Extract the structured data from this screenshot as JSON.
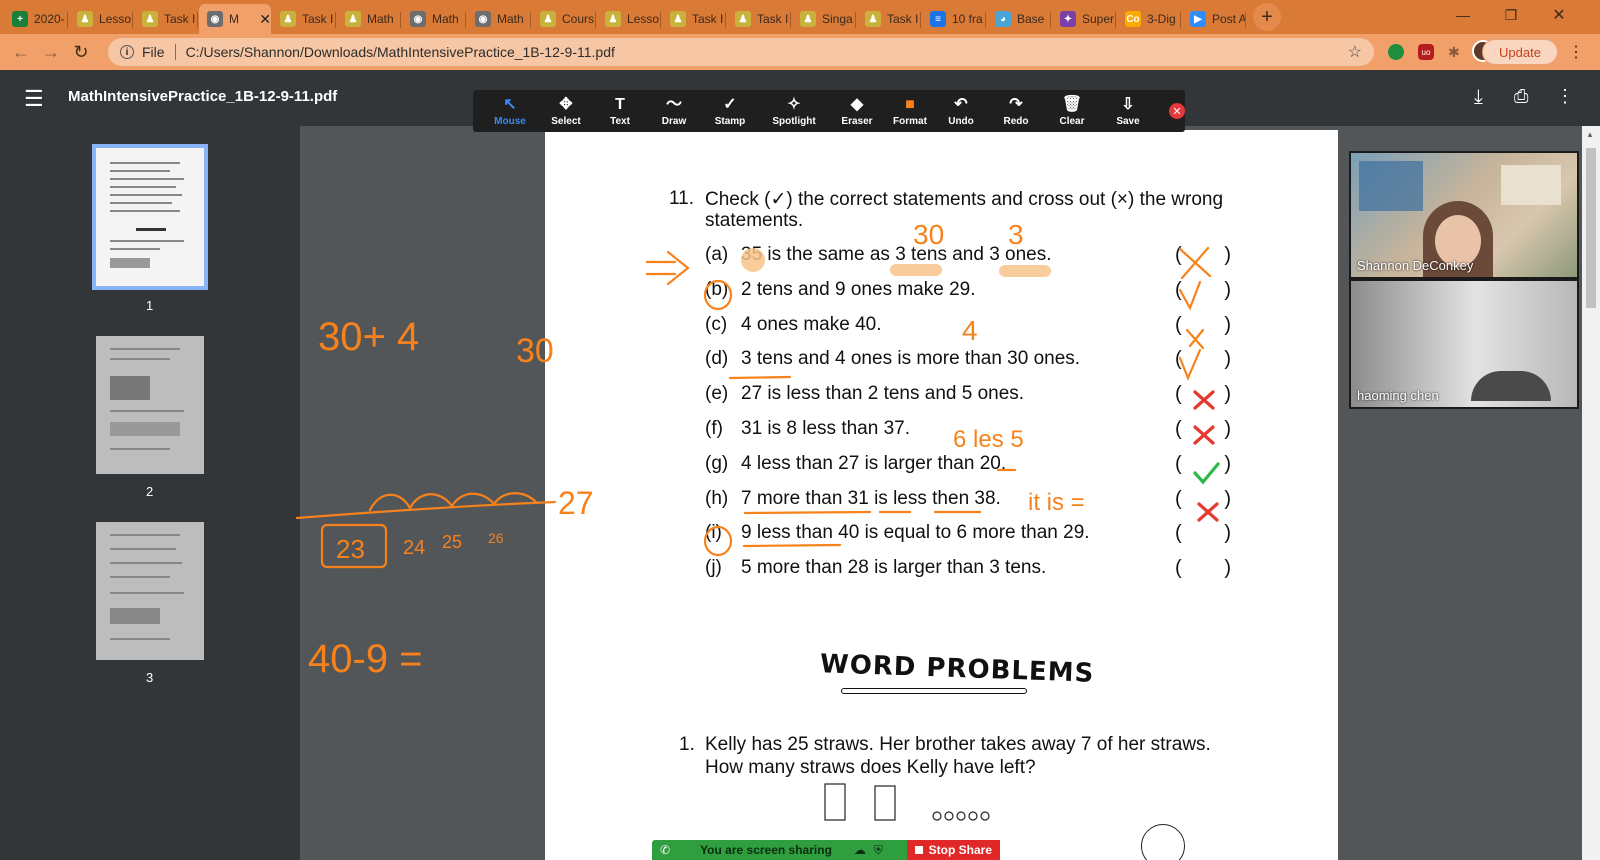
{
  "browser": {
    "tabs": [
      {
        "label": "2020-",
        "fav": "+",
        "color": "#188038"
      },
      {
        "label": "Lesso",
        "fav": "♟",
        "color": "#c9b23c"
      },
      {
        "label": "Task I",
        "fav": "♟",
        "color": "#c9b23c"
      },
      {
        "label": "M",
        "fav": "◉",
        "color": "#6d6d6d",
        "active": true
      },
      {
        "label": "Task I",
        "fav": "♟",
        "color": "#c9b23c"
      },
      {
        "label": "Math",
        "fav": "♟",
        "color": "#c9b23c"
      },
      {
        "label": "Math",
        "fav": "◉",
        "color": "#6d6d6d"
      },
      {
        "label": "Math",
        "fav": "◉",
        "color": "#6d6d6d"
      },
      {
        "label": "Cours",
        "fav": "♟",
        "color": "#c9b23c"
      },
      {
        "label": "Lesso",
        "fav": "♟",
        "color": "#c9b23c"
      },
      {
        "label": "Task I",
        "fav": "♟",
        "color": "#c9b23c"
      },
      {
        "label": "Task I",
        "fav": "♟",
        "color": "#c9b23c"
      },
      {
        "label": "Singa",
        "fav": "♟",
        "color": "#c9b23c"
      },
      {
        "label": "Task I",
        "fav": "♟",
        "color": "#c9b23c"
      },
      {
        "label": "10 fra",
        "fav": "≡",
        "color": "#1a73e8"
      },
      {
        "label": "Base",
        "fav": "◕",
        "color": "#49a5d8"
      },
      {
        "label": "Super",
        "fav": "✦",
        "color": "#7b3fa8"
      },
      {
        "label": "3-Dig",
        "fav": "Co",
        "color": "#f9ab00"
      },
      {
        "label": "Post A",
        "fav": "▶",
        "color": "#2d8cff"
      }
    ],
    "address": "C:/Users/Shannon/Downloads/MathIntensivePractice_1B-12-9-11.pdf",
    "address_prefix": "File",
    "update_label": "Update"
  },
  "pdf": {
    "filename": "MathIntensivePractice_1B-12-9-11.pdf",
    "thumbnails": [
      "1",
      "2",
      "3"
    ]
  },
  "annotate": {
    "tools": [
      {
        "label": "Mouse",
        "icon": "↖",
        "name": "mouse-tool",
        "active": true
      },
      {
        "label": "Select",
        "icon": "✥",
        "name": "select-tool"
      },
      {
        "label": "Text",
        "icon": "T",
        "name": "text-tool"
      },
      {
        "label": "Draw",
        "icon": "〜",
        "name": "draw-tool"
      },
      {
        "label": "Stamp",
        "icon": "✓",
        "name": "stamp-tool"
      },
      {
        "label": "Spotlight",
        "icon": "✧",
        "name": "spotlight-tool"
      },
      {
        "label": "Eraser",
        "icon": "◆",
        "name": "eraser-tool"
      },
      {
        "label": "Format",
        "icon": "■",
        "name": "format-tool"
      },
      {
        "label": "Undo",
        "icon": "↶",
        "name": "undo-tool"
      },
      {
        "label": "Redo",
        "icon": "↷",
        "name": "redo-tool"
      },
      {
        "label": "Clear",
        "icon": "🗑",
        "name": "clear-tool"
      },
      {
        "label": "Save",
        "icon": "⇩",
        "name": "save-tool"
      }
    ]
  },
  "worksheet": {
    "q_number": "11.",
    "q_line1": "Check (✓) the correct statements and cross out (×) the wrong",
    "q_line2": "statements.",
    "statements": [
      {
        "label": "(a)",
        "text": "35 is the same as 3 tens and 3 ones."
      },
      {
        "label": "(b)",
        "text": "2 tens and 9 ones make 29."
      },
      {
        "label": "(c)",
        "text": "4 ones make 40."
      },
      {
        "label": "(d)",
        "text": "3 tens and 4 ones is more than 30 ones."
      },
      {
        "label": "(e)",
        "text": "27 is less than 2 tens and 5 ones."
      },
      {
        "label": "(f)",
        "text": "31 is 8 less than 37."
      },
      {
        "label": "(g)",
        "text": "4 less than 27 is larger than 20."
      },
      {
        "label": "(h)",
        "text": "7 more than 31 is less then 38."
      },
      {
        "label": "(i)",
        "text": "9 less than 40 is equal to 6 more than 29."
      },
      {
        "label": "(j)",
        "text": "5 more than 28 is larger than 3 tens."
      }
    ],
    "word_problems_title": "WORD PROBLEMS",
    "wp1_number": "1.",
    "wp1_line1": "Kelly has 25 straws.  Her brother takes away 7 of her straws.",
    "wp1_line2": "How many straws does Kelly have left?"
  },
  "ink": {
    "color": "#f7821b",
    "a_hint_tens": "30",
    "a_hint_ones": "3",
    "c_hint": "4",
    "f_hint": "6 les 5",
    "h_hint": "it is =",
    "side_sum": "30+ 4",
    "side_30": "30",
    "jump_end": "27",
    "jump_start": "23",
    "jump_24": "24",
    "jump_25": "25",
    "jump_26": "26",
    "side_subtract": "40-9 ="
  },
  "participants": [
    {
      "name": "Shannon DeConkey"
    },
    {
      "name": "haoming chen"
    }
  ],
  "share": {
    "status": "You are screen sharing",
    "stop_label": "Stop Share"
  }
}
